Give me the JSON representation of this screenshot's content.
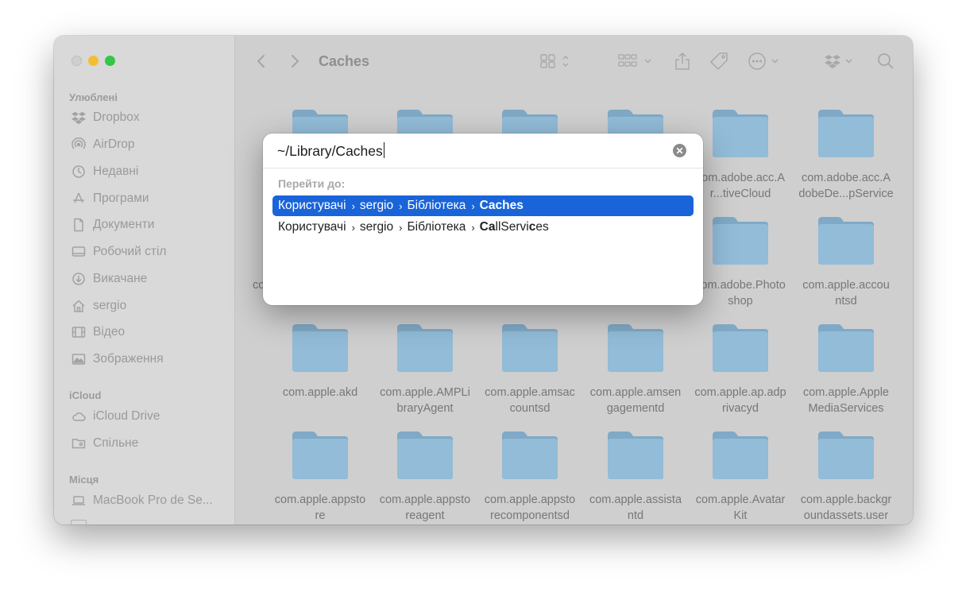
{
  "window": {
    "title": "Caches",
    "traffic_lights": {
      "close": "#cfcfcf",
      "minimize": "#f2bf32",
      "zoom": "#33c748"
    }
  },
  "sidebar": {
    "favorites_title": "Улюблені",
    "favorites": [
      {
        "label": "Dropbox",
        "icon": "dropbox-icon"
      },
      {
        "label": "AirDrop",
        "icon": "airdrop-icon"
      },
      {
        "label": "Недавні",
        "icon": "clock-icon"
      },
      {
        "label": "Програми",
        "icon": "apps-icon"
      },
      {
        "label": "Документи",
        "icon": "document-icon"
      },
      {
        "label": "Робочий стіл",
        "icon": "desktop-icon"
      },
      {
        "label": "Викачане",
        "icon": "download-icon"
      },
      {
        "label": "sergio",
        "icon": "home-icon"
      },
      {
        "label": "Відео",
        "icon": "film-icon"
      },
      {
        "label": "Зображення",
        "icon": "photo-icon"
      }
    ],
    "icloud_title": "iCloud",
    "icloud": [
      {
        "label": "iCloud Drive",
        "icon": "cloud-icon"
      },
      {
        "label": "Спільне",
        "icon": "shared-folder-icon"
      }
    ],
    "locations_title": "Місця",
    "locations": [
      {
        "label": "MacBook Pro de Se...",
        "icon": "laptop-icon"
      }
    ]
  },
  "files": [
    "",
    "",
    "",
    "",
    "com.adobe.acc.A\nr...tiveCloud",
    "com.adobe.acc.A\ndobeDe...pService",
    "com.",
    "",
    "",
    "",
    "com.adobe.Photo\nshop",
    "com.apple.accou\nntsd",
    "com.apple.akd",
    "com.apple.AMPLi\nbraryAgent",
    "com.apple.amsac\ncountsd",
    "com.apple.amsen\ngagementd",
    "com.apple.ap.adp\nrivacyd",
    "com.apple.Apple\nMediaServices",
    "com.apple.appsto\nre",
    "com.apple.appsto\nreagent",
    "com.apple.appsto\nrecomponentsd",
    "com.apple.assista\nntd",
    "com.apple.Avatar\nKit",
    "com.apple.backgr\noundassets.user"
  ],
  "dialog": {
    "path_value": "~/Library/Caches",
    "goto_label": "Перейти до:",
    "suggestions": [
      {
        "parts": [
          "Користувачі",
          "sergio",
          "Бібліотека"
        ],
        "last": "Caches",
        "selected": true
      },
      {
        "parts": [
          "Користувачі",
          "sergio",
          "Бібліотека"
        ],
        "last_bold_1": "Ca",
        "last_plain_1": "llServi",
        "last_bold_2": "c",
        "last_plain_2": "es",
        "selected": false
      }
    ],
    "separator": "›"
  }
}
